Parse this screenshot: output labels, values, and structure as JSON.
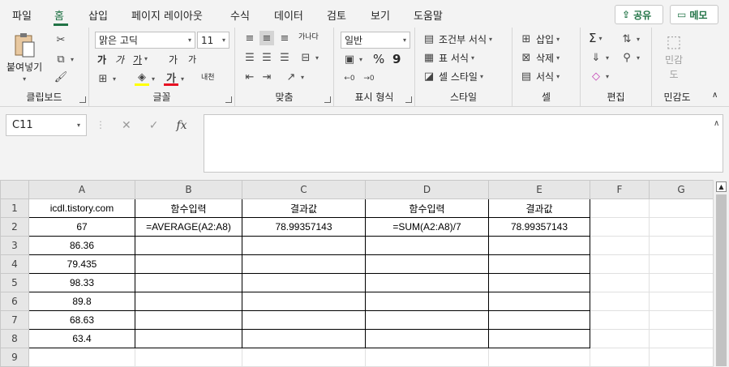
{
  "menu": {
    "items": [
      "파일",
      "홈",
      "삽입",
      "페이지 레이아웃",
      "수식",
      "데이터",
      "검토",
      "보기",
      "도움말"
    ],
    "active": "홈",
    "share_label": "공유",
    "memo_label": "메모"
  },
  "ribbon": {
    "clipboard": {
      "paste_label_1": "붙여넣기",
      "group_label": "클립보드"
    },
    "font": {
      "font_name": "맑은 고딕",
      "font_size": "11",
      "bold": "가",
      "italic": "가",
      "underline": "가",
      "grow": "가",
      "shrink": "가",
      "phonetic": "내천",
      "fill_letter": "가",
      "group_label": "글꼴"
    },
    "alignment": {
      "wrap": "가나다",
      "group_label": "맞춤"
    },
    "number": {
      "format": "일반",
      "percent": "%",
      "comma": "9",
      "group_label": "표시 형식"
    },
    "styles": {
      "conditional": "조건부 서식",
      "table": "표 서식",
      "cell": "셀 스타일",
      "group_label": "스타일"
    },
    "cells": {
      "insert": "삽입",
      "delete": "삭제",
      "format": "서식",
      "group_label": "셀"
    },
    "editing": {
      "sum": "Σ",
      "group_label": "편집"
    },
    "sensitivity": {
      "label_1": "민감",
      "label_2": "도",
      "group_label": "민감도"
    }
  },
  "formula_bar": {
    "name_box": "C11",
    "fx": "fx",
    "formula": ""
  },
  "sheet": {
    "columns": [
      "A",
      "B",
      "C",
      "D",
      "E",
      "F",
      "G"
    ],
    "rows": [
      {
        "n": "1",
        "cells": [
          "icdl.tistory.com",
          "함수입력",
          "결과값",
          "함수입력",
          "결과값",
          "",
          ""
        ]
      },
      {
        "n": "2",
        "cells": [
          "67",
          "=AVERAGE(A2:A8)",
          "78.99357143",
          "=SUM(A2:A8)/7",
          "78.99357143",
          "",
          ""
        ]
      },
      {
        "n": "3",
        "cells": [
          "86.36",
          "",
          "",
          "",
          "",
          "",
          ""
        ]
      },
      {
        "n": "4",
        "cells": [
          "79.435",
          "",
          "",
          "",
          "",
          "",
          ""
        ]
      },
      {
        "n": "5",
        "cells": [
          "98.33",
          "",
          "",
          "",
          "",
          "",
          ""
        ]
      },
      {
        "n": "6",
        "cells": [
          "89.8",
          "",
          "",
          "",
          "",
          "",
          ""
        ]
      },
      {
        "n": "7",
        "cells": [
          "68.63",
          "",
          "",
          "",
          "",
          "",
          ""
        ]
      },
      {
        "n": "8",
        "cells": [
          "63.4",
          "",
          "",
          "",
          "",
          "",
          ""
        ]
      },
      {
        "n": "9",
        "cells": [
          "",
          "",
          "",
          "",
          "",
          "",
          ""
        ]
      }
    ]
  },
  "colors": {
    "accent": "#217346",
    "font_color": "#e81123",
    "fill_color": "#ffff00"
  }
}
